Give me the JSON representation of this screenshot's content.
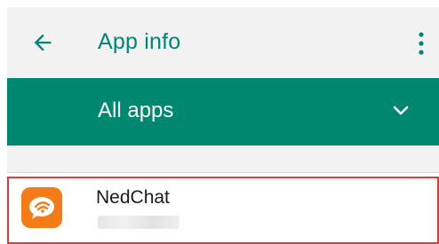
{
  "header": {
    "title": "App info",
    "back_icon": "arrow-back-icon",
    "menu_icon": "more-vert-icon"
  },
  "filter": {
    "label": "All apps",
    "dropdown_icon": "chevron-down-icon"
  },
  "apps": [
    {
      "name": "NedChat",
      "icon": "nedchat-app-icon",
      "icon_color": "#f57b16",
      "highlighted": true
    }
  ],
  "colors": {
    "accent": "#008577",
    "filter_bar": "#00876f",
    "highlight_border": "#e53935",
    "app_bar_bg": "#f2f2f2"
  }
}
